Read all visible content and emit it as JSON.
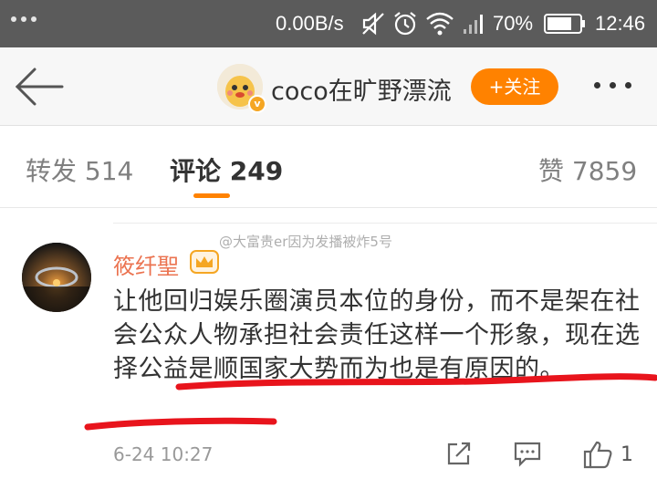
{
  "status_bar": {
    "network_speed": "0.00B/s",
    "battery": "70%",
    "time": "12:46"
  },
  "header": {
    "title": "coco在旷野漂流",
    "follow_label": "+关注",
    "verified_badge": "v"
  },
  "tabs": [
    {
      "label": "转发",
      "count": "514"
    },
    {
      "label": "评论",
      "count": "249"
    },
    {
      "label": "赞",
      "count": "7859"
    }
  ],
  "watermark": "@大富贵er因为发播被炸5号",
  "comment": {
    "username": "筱纤聖",
    "text": "让他回归娱乐圈演员本位的身份，而不是架在社会公众人物承担社会责任这样一个形象，现在选择公益是顺国家大势而为也是有原因的。",
    "time": "6-24 10:27",
    "like_count": "1"
  },
  "colors": {
    "accent": "#ff8200",
    "username": "#eb7350",
    "status_bar": "#5b5b5b",
    "scribble": "#e8141c"
  },
  "icons": [
    "wifi-icon",
    "mute-icon",
    "alarm-icon",
    "signal-icon",
    "battery-icon",
    "back-arrow-icon",
    "more-icon",
    "crown-badge-icon",
    "share-icon",
    "comment-icon",
    "like-icon"
  ]
}
